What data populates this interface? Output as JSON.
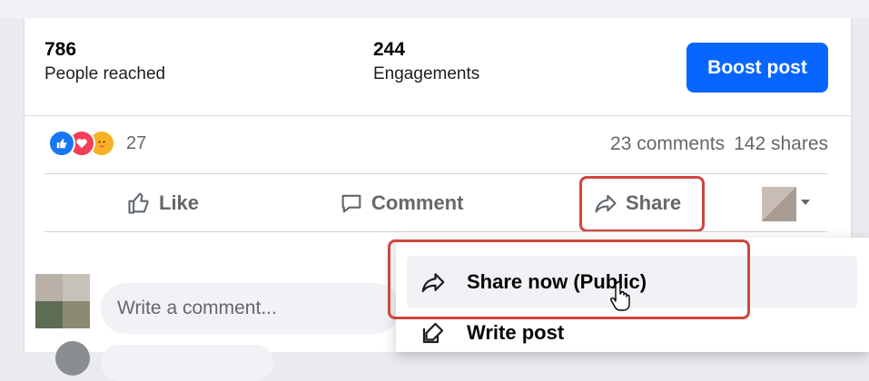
{
  "stats": [
    {
      "value": "786",
      "label": "People reached"
    },
    {
      "value": "244",
      "label": "Engagements"
    }
  ],
  "boost_label": "Boost post",
  "reactions": {
    "count": "27",
    "icons": [
      "like-icon",
      "love-icon",
      "care-icon"
    ]
  },
  "meta": {
    "comments": "23 comments",
    "shares": "142 shares"
  },
  "actions": {
    "like": "Like",
    "comment": "Comment",
    "share": "Share"
  },
  "comment_box": {
    "placeholder": "Write a comment..."
  },
  "share_menu": [
    {
      "label": "Share now (Public)",
      "icon": "share-arrow-icon"
    },
    {
      "label": "Write post",
      "icon": "edit-icon"
    }
  ],
  "colors": {
    "brand": "#0866ff",
    "highlight": "#d0463e",
    "muted": "#65676b"
  }
}
